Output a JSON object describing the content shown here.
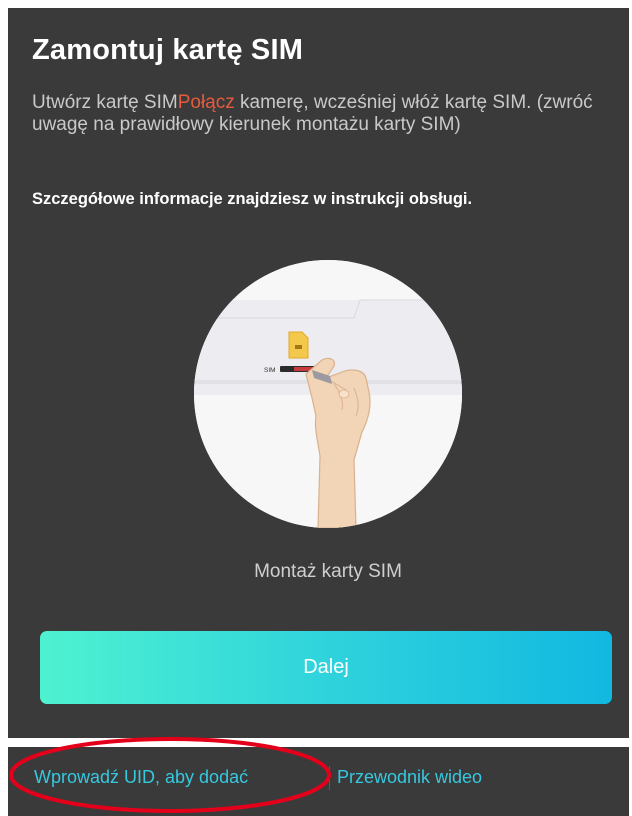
{
  "screen": {
    "title": "Zamontuj kartę SIM",
    "description": {
      "before": "Utwórz kartę SIM",
      "highlight": "Połącz",
      "after": "  kamerę, wcześniej włóż kartę SIM. (zwróć uwagę na prawidłowy kierunek montażu karty SIM)"
    },
    "note": "Szczegółowe informacje znajdziesz w instrukcji obsługi.",
    "illustration": {
      "slot_label": "SIM"
    },
    "caption": "Montaż karty SIM",
    "next_button": "Dalej"
  },
  "footer": {
    "uid_link": "Wprowadź UID, aby dodać",
    "video_link": "Przewodnik wideo"
  },
  "colors": {
    "panel_bg": "#3a3a3a",
    "accent": "#e85a3c",
    "link": "#35c8df",
    "button_gradient_start": "#4ef2d0",
    "button_gradient_end": "#12b8e0",
    "highlight_ring": "#e4001b"
  }
}
